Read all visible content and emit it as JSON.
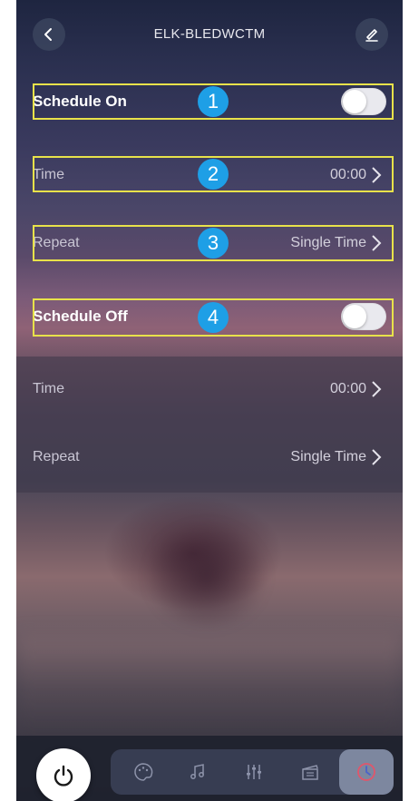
{
  "header": {
    "title": "ELK-BLEDWCTM",
    "back_icon": "chevron-left-icon",
    "edit_icon": "pencil-icon"
  },
  "schedule_on": {
    "label": "Schedule On",
    "enabled": false,
    "time_label": "Time",
    "time_value": "00:00",
    "repeat_label": "Repeat",
    "repeat_value": "Single Time"
  },
  "schedule_off": {
    "label": "Schedule Off",
    "enabled": false,
    "time_label": "Time",
    "time_value": "00:00",
    "repeat_label": "Repeat",
    "repeat_value": "Single Time"
  },
  "annotations": [
    "1",
    "2",
    "3",
    "4"
  ],
  "bottom_nav": {
    "power_icon": "power-icon",
    "tabs": [
      {
        "icon": "palette-icon",
        "active": false
      },
      {
        "icon": "music-note-icon",
        "active": false
      },
      {
        "icon": "sliders-icon",
        "active": false
      },
      {
        "icon": "clapperboard-icon",
        "active": false
      },
      {
        "icon": "timer-icon",
        "active": true
      }
    ]
  },
  "colors": {
    "highlight": "#e8e24a",
    "badge": "#1e9fe6",
    "timer_accent": "#e0566b"
  }
}
